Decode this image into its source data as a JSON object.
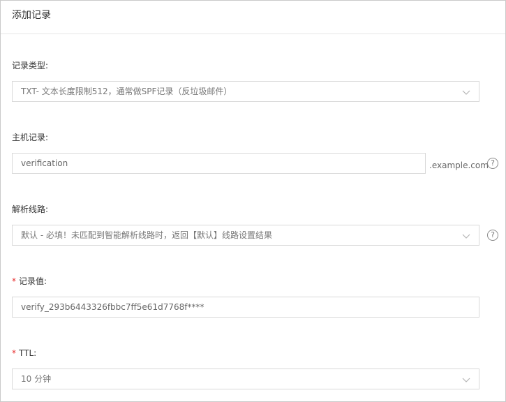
{
  "dialog": {
    "title": "添加记录"
  },
  "record_type": {
    "label": "记录类型:",
    "value": "TXT- 文本长度限制512，通常做SPF记录（反垃圾邮件）"
  },
  "host_record": {
    "label": "主机记录:",
    "value": "verification",
    "suffix": ".example.com",
    "help_icon": "question-circle-icon"
  },
  "line": {
    "label": "解析线路:",
    "value": "默认 - 必填！未匹配到智能解析线路时，返回【默认】线路设置结果",
    "help_icon": "question-circle-icon"
  },
  "record_value": {
    "required_mark": "*",
    "label": "记录值:",
    "value": "verify_293b6443326fbbc7ff5e61d7768f****"
  },
  "ttl": {
    "required_mark": "*",
    "label": "TTL:",
    "value": "10 分钟"
  },
  "colors": {
    "required": "#e72b2b",
    "border": "#d9d9d9"
  }
}
